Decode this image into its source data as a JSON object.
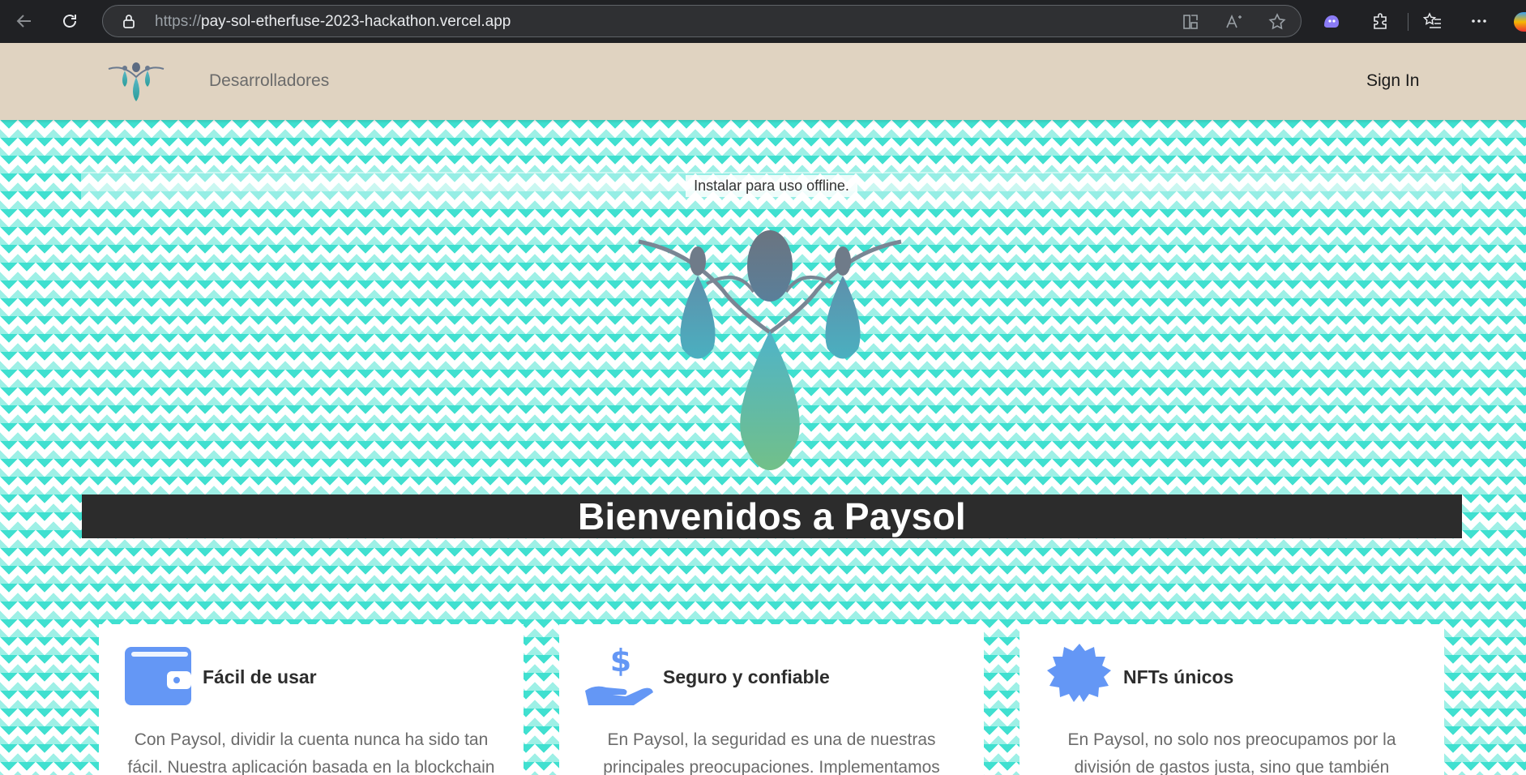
{
  "browser": {
    "url_protocol": "https://",
    "url_host": "pay-sol-etherfuse-2023-hackathon.vercel.app"
  },
  "header": {
    "nav_link": "Desarrolladores",
    "sign_in": "Sign In"
  },
  "hero": {
    "install_text": "Instalar para uso offline.",
    "title": "Bienvenidos a Paysol"
  },
  "features": [
    {
      "title": "Fácil de usar",
      "icon": "wallet-icon",
      "body": "Con Paysol, dividir la cuenta nunca ha sido tan fácil. Nuestra aplicación basada en la blockchain"
    },
    {
      "title": "Seguro y confiable",
      "icon": "hand-dollar-icon",
      "body": "En Paysol, la seguridad es una de nuestras principales preocupaciones. Implementamos"
    },
    {
      "title": "NFTs únicos",
      "icon": "badge-icon",
      "body": "En Paysol, no solo nos preocupamos por la división de gastos justa, sino que también"
    }
  ],
  "colors": {
    "accent_icon": "#6497f5",
    "header_bg": "#e0d3c1",
    "pattern_teal": "#40e0d0"
  }
}
